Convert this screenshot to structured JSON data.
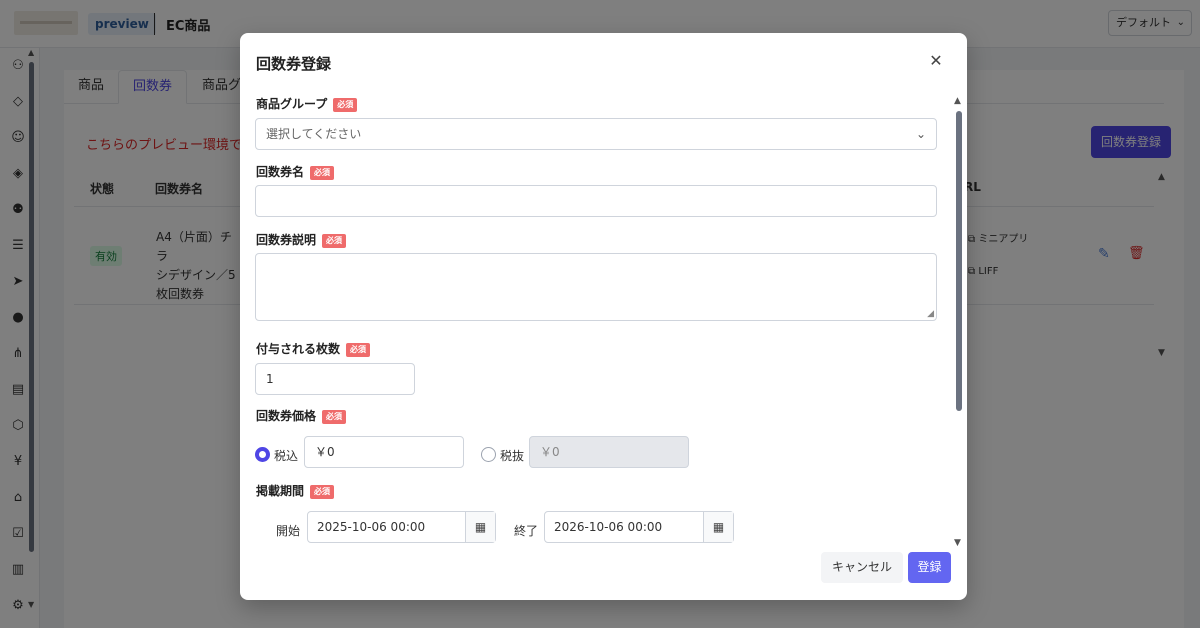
{
  "header": {
    "preview_badge": "preview",
    "page_title": "EC商品",
    "layout_select": "デフォルト"
  },
  "tabs": [
    {
      "label": "商品"
    },
    {
      "label": "回数券"
    },
    {
      "label": "商品グ"
    }
  ],
  "main": {
    "warning": "こちらのプレビュー環境では",
    "register_button": "回数券登録",
    "columns": [
      "状態",
      "回数券名",
      "RL"
    ],
    "row": {
      "status": "有効",
      "name_lines": [
        "A4（片面）チラ",
        "シデザイン／5",
        "枚回数券"
      ],
      "url_items": [
        "ミニアプリ",
        "LIFF"
      ]
    }
  },
  "modal": {
    "title": "回数券登録",
    "required_badge": "必須",
    "product_group": {
      "label": "商品グループ",
      "placeholder": "選択してください"
    },
    "ticket_name": {
      "label": "回数券名",
      "value": ""
    },
    "ticket_description": {
      "label": "回数券説明",
      "value": ""
    },
    "ticket_count": {
      "label": "付与される枚数",
      "value": "1"
    },
    "ticket_price": {
      "label": "回数券価格",
      "tax_included_label": "税込",
      "tax_included_value": "￥0",
      "tax_excluded_label": "税抜",
      "tax_excluded_value": "￥0",
      "selected": "税込"
    },
    "publish_period": {
      "label": "掲載期間",
      "start_label": "開始",
      "start_value": "2025-10-06 00:00",
      "end_label": "終了",
      "end_value": "2026-10-06 00:00"
    },
    "cancel_label": "キャンセル",
    "submit_label": "登録"
  },
  "colors": {
    "accent": "#4f46e5",
    "required": "#ef6b6b",
    "warning": "#dc2626"
  }
}
